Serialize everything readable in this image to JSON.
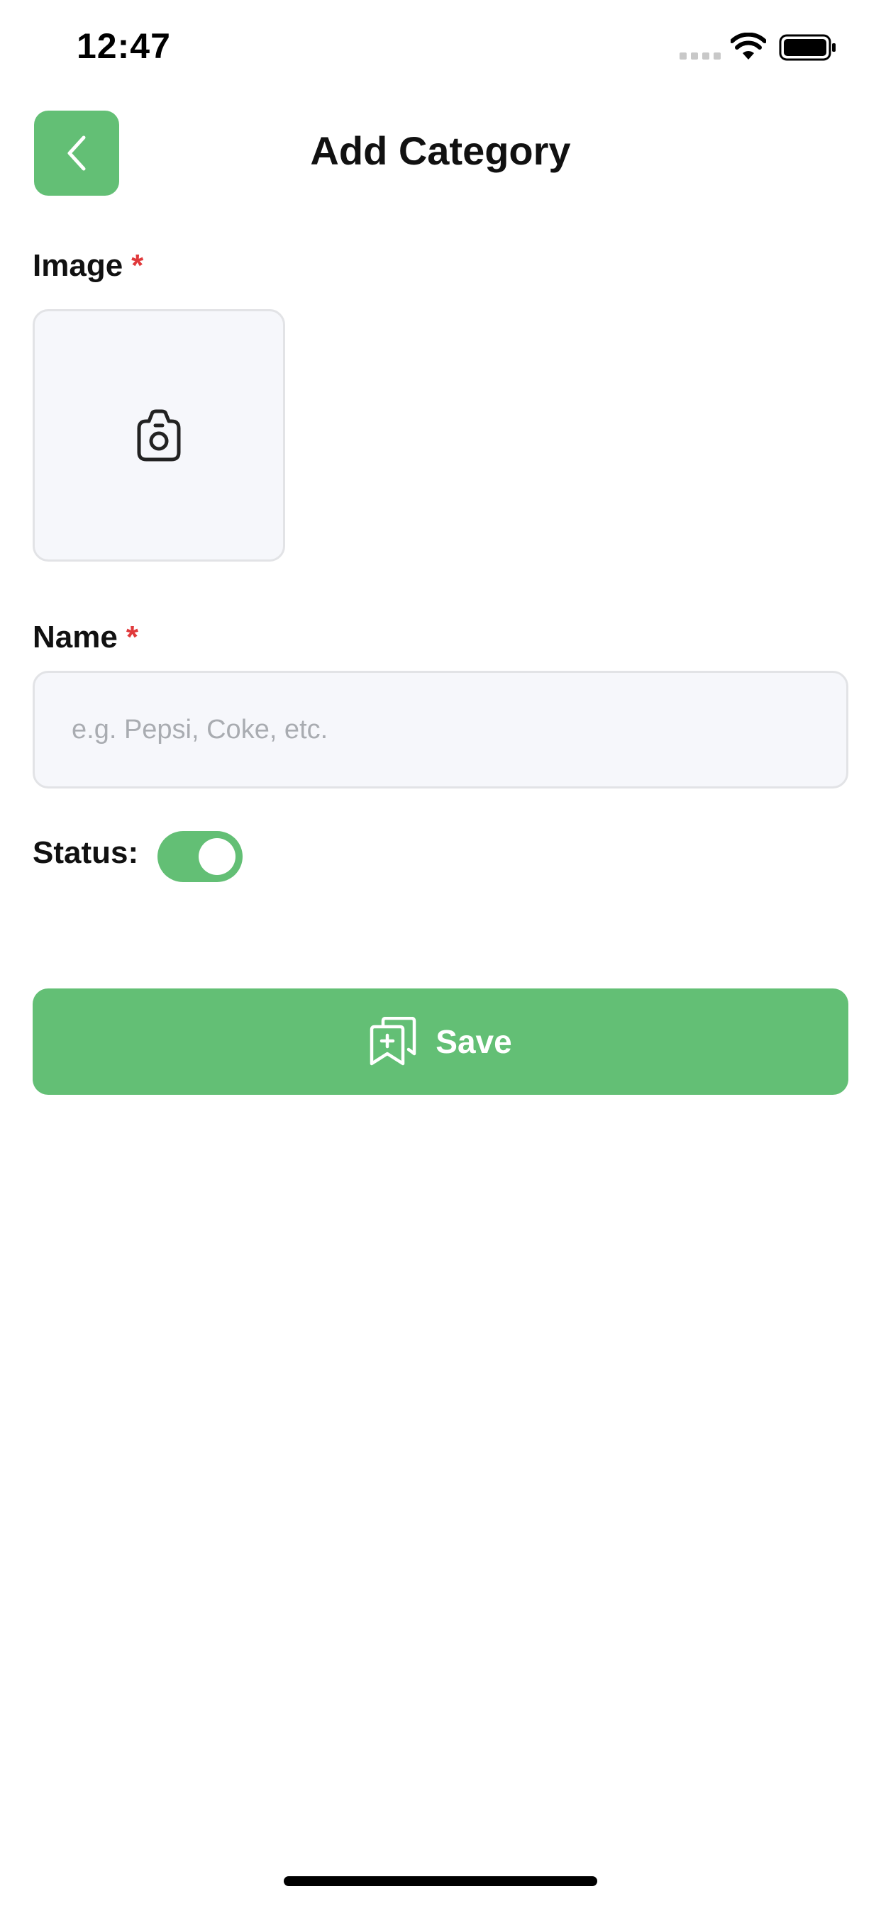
{
  "status_bar": {
    "time": "12:47"
  },
  "header": {
    "title": "Add Category",
    "back_icon": "chevron-left-icon"
  },
  "form": {
    "image": {
      "label": "Image",
      "required_mark": "*",
      "icon": "camera-icon"
    },
    "name": {
      "label": "Name",
      "required_mark": "*",
      "value": "",
      "placeholder": "e.g. Pepsi, Coke, etc."
    },
    "status": {
      "label": "Status:",
      "enabled": true
    },
    "save": {
      "label": "Save",
      "icon": "save-bookmark-icon"
    }
  },
  "colors": {
    "accent": "#63bf75",
    "required": "#e0393b",
    "field_background": "#f6f7fb",
    "field_border": "#e2e3e6",
    "placeholder": "#a9acb1"
  }
}
